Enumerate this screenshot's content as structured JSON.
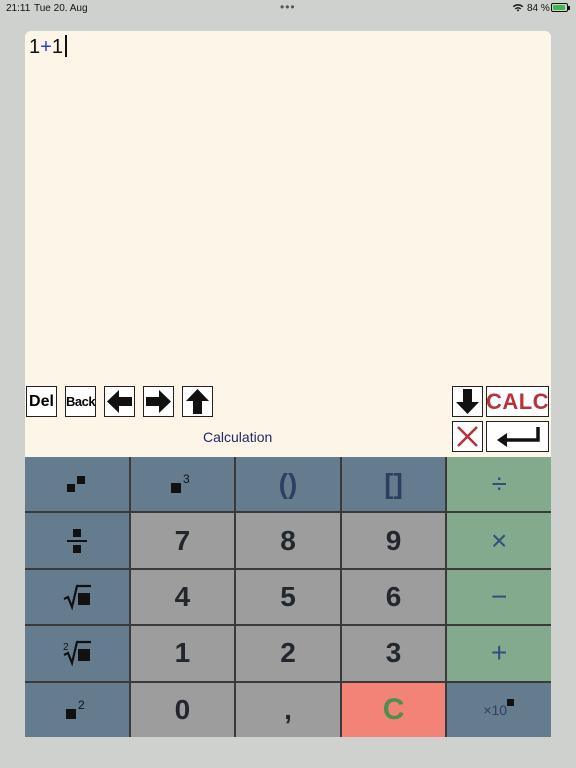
{
  "status": {
    "time": "21:11",
    "date": "Tue 20. Aug",
    "dots": "•••",
    "battery_pct": "84 %"
  },
  "display": {
    "expression_left": "1",
    "expression_op": "+",
    "expression_right": "1",
    "mode_label": "Calculation"
  },
  "toolbar": {
    "del": "Del",
    "back": "Back",
    "calc": "CALC"
  },
  "keys": {
    "open_close_paren": "()",
    "brackets": "[]",
    "divide": "÷",
    "seven": "7",
    "eight": "8",
    "nine": "9",
    "multiply": "×",
    "four": "4",
    "five": "5",
    "six": "6",
    "minus": "−",
    "one": "1",
    "two": "2",
    "three": "3",
    "plus": "+",
    "zero": "0",
    "comma": ",",
    "clear": "C",
    "sci_base": "×10"
  },
  "colors": {
    "panel_bg": "#fdf5e7",
    "key_blue": "#657b8e",
    "key_gray": "#9d9d9d",
    "key_green": "#83aa8c",
    "key_red": "#f38376",
    "calc_text": "#b8323a"
  }
}
